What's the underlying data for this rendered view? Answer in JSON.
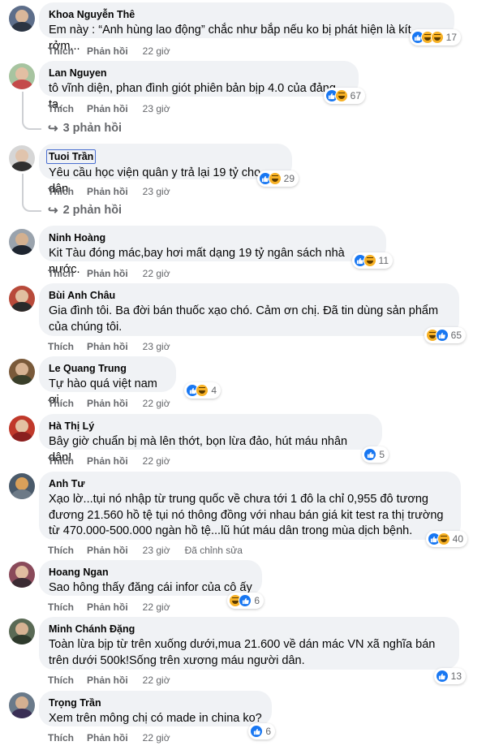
{
  "colors": {
    "bubble": "#f0f2f5",
    "secondary_text": "#65676b",
    "like_blue": "#1877f2",
    "haha_yellow": "#f7b125"
  },
  "labels": {
    "like": "Thích",
    "reply": "Phản hồi",
    "edited": "Đã chỉnh sửa"
  },
  "comments": [
    {
      "name": "Khoa Nguyễn Thê",
      "text": "Em này : “Anh hùng lao động” chắc như bắp nếu ko bị phát hiện là kít rởm...",
      "time": "22 giờ",
      "reactions": [
        "like",
        "haha",
        "haha"
      ],
      "count": "17"
    },
    {
      "name": "Lan Nguyen",
      "text": "tô vĩnh diện, phan đình giót phiên bản bịp 4.0 của đảng ta.",
      "time": "23 giờ",
      "reactions": [
        "like",
        "haha"
      ],
      "count": "67",
      "replies": "3 phản hồi"
    },
    {
      "name": "Tuoi Trần",
      "text": "Yêu cầu học viện quân y trả lại 19 tỷ cho dân",
      "time": "23 giờ",
      "reactions": [
        "like",
        "haha"
      ],
      "count": "29",
      "replies": "2 phản hồi"
    },
    {
      "name": "Ninh Hoàng",
      "text": "Kit Tàu đóng mác,bay hơi mất dạng 19 tỷ ngân sách nhà nước.",
      "time": "22 giờ",
      "reactions": [
        "like",
        "haha"
      ],
      "count": "11"
    },
    {
      "name": "Bùi Anh Châu",
      "text": "Gia đình tôi. Ba đời bán thuốc xạo chó. Cảm ơn chị. Đã tin dùng sản phẩm của chúng tôi.",
      "time": "23 giờ",
      "reactions": [
        "haha",
        "like"
      ],
      "count": "65"
    },
    {
      "name": "Le Quang Trung",
      "text": "Tự hào quá việt nam ơi",
      "time": "22 giờ",
      "reactions": [
        "like",
        "haha"
      ],
      "count": "4"
    },
    {
      "name": "Hà Thị Lý",
      "text": "Bây giờ chuẩn bị mà lên thớt, bọn lừa đảo, hút máu nhân dân!",
      "time": "22 giờ",
      "reactions": [
        "like"
      ],
      "count": "5"
    },
    {
      "name": "Anh Tư",
      "text": "Xạo lờ...tụi nó nhập từ trung quốc về chưa tới 1 đô la chỉ 0,955 đô tương đương 21.560 hồ tệ tụi nó thông đồng với nhau bán giá kit test ra thị trường từ 470.000-500.000 ngàn hồ tệ...lũ hút máu dân trong mùa dịch bệnh.",
      "time": "23 giờ",
      "reactions": [
        "like",
        "haha"
      ],
      "count": "40",
      "edited": true
    },
    {
      "name": "Hoang Ngan",
      "text": "Sao hông thấy đăng cái infor của cô ấy",
      "time": "22 giờ",
      "reactions": [
        "haha",
        "like"
      ],
      "count": "6"
    },
    {
      "name": "Minh Chánh Đặng",
      "text": "Toàn lừa bịp từ trên xuống dưới,mua 21.600 về dán mác VN xã nghĩa bán trên dưới 500k!Sống trên xương máu người dân.",
      "time": "22 giờ",
      "reactions": [
        "like"
      ],
      "count": "13"
    },
    {
      "name": "Trọng Trần",
      "text": "Xem trên mông chị có made in china ko?",
      "time": "22 giờ",
      "reactions": [
        "like"
      ],
      "count": "6"
    }
  ]
}
